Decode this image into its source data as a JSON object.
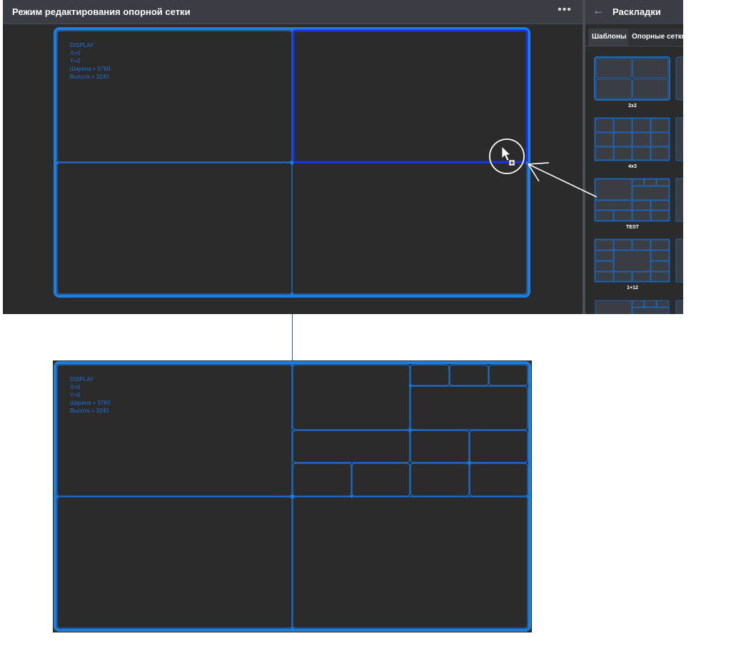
{
  "editor": {
    "title": "Режим редактирования опорной сетки",
    "more_icon": "more-horizontal-icon",
    "more_glyph": "•••"
  },
  "grid_info": {
    "name": "DISPLAY",
    "x": "X=0",
    "y": "Y=0",
    "width": "Ширина = 5760",
    "height": "Высота = 3240"
  },
  "sidebar": {
    "title": "Раскладки",
    "back_icon": "arrow-left-icon",
    "back_glyph": "←",
    "tabs": [
      {
        "label": "Шаблоны"
      },
      {
        "label": "Опорные сетки"
      }
    ],
    "layouts": [
      {
        "label": "2x2"
      },
      {
        "label": "4x3"
      },
      {
        "label": "TEST"
      },
      {
        "label": "1+12"
      }
    ]
  },
  "colors": {
    "background": "#2b2b2b",
    "header": "#3a3d44",
    "accent": "#1a7fe0",
    "cell_line": "#1a6fd0",
    "selected": "#1a2fe8"
  }
}
